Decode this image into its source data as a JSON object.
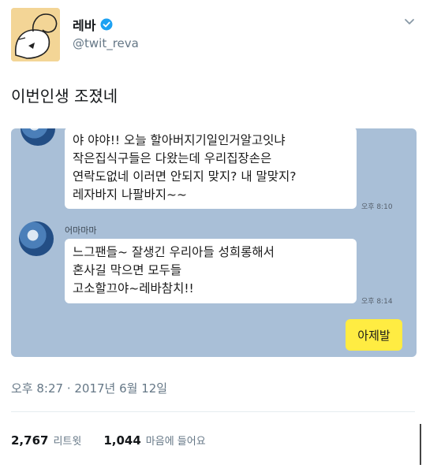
{
  "author": {
    "display_name": "레바",
    "handle": "@twit_reva"
  },
  "tweet": {
    "text": "이번인생 조졌네",
    "timestamp": "오후 8:27 · 2017년 6월 12일"
  },
  "chat": {
    "message1": {
      "lines": [
        "야 야야!! 오늘 할아버지기일인거알고잇냐",
        "작은집식구들은 다왔는데 우리집장손은",
        "연락도없네 이러면 안되지 맞지? 내 말맞지?",
        "레자바지 나팔바지~~"
      ],
      "time": "오후 8:10"
    },
    "message2": {
      "sender": "어마마마",
      "lines": [
        "느그팬들~ 잘생긴 우리아들 성희롱해서",
        "혼사길 막으면 모두들",
        "고소할끄야~레바참치!!"
      ],
      "time": "오후 8:14"
    },
    "reply": "아제발"
  },
  "stats": {
    "retweets_count": "2,767",
    "retweets_label": "리트윗",
    "likes_count": "1,044",
    "likes_label": "마음에 들어요"
  },
  "colors": {
    "chat_background": "#a9bfd7",
    "my_bubble": "#ffec42",
    "verified": "#1da1f2",
    "secondary_text": "#657786"
  },
  "icons": [
    "avatar-cartoon",
    "verified-badge-icon",
    "chevron-down-icon",
    "chat-avatar-icon"
  ]
}
